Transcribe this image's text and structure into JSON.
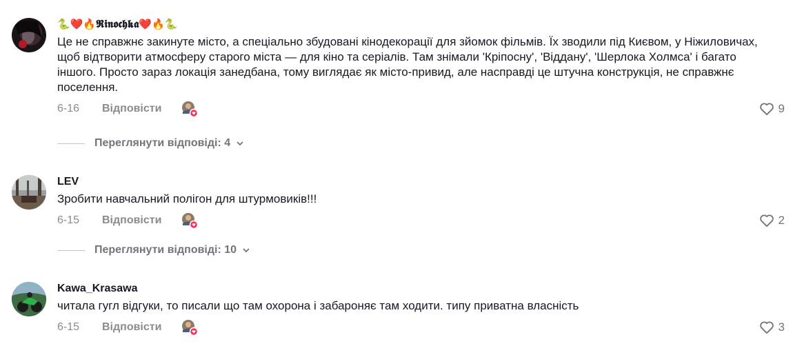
{
  "comments": [
    {
      "author_prefix": "🐍❤️🔥",
      "author_name": "𝕽𝖎𝖓𝖔𝖈𝖍𝖐𝖆",
      "author_suffix": "❤️🔥🐍",
      "text": "Це не справжнє закинуте місто, а спеціально збудовані кінодекорації для зйомок фільмів. Їх зводили під Києвом, у Ніжиловичах, щоб відтворити атмосферу старого міста — для кіно та серіалів. Там знімали 'Кріпосну', 'Віддану', 'Шерлока Холмса' і багато іншого. Просто зараз локація занедбана, тому виглядає як місто-привид, але насправді це штучна конструкція, не справжнє поселення.",
      "date": "6-16",
      "reply_label": "Відповісти",
      "likes": "9",
      "view_replies": "Переглянути відповіді: 4"
    },
    {
      "author_name": "LEV",
      "text": "Зробити навчальний полігон для штурмовиків!!!",
      "date": "6-15",
      "reply_label": "Відповісти",
      "likes": "2",
      "view_replies": "Переглянути відповіді: 10"
    },
    {
      "author_name": "Kawa_Krasawa",
      "text": "читала гугл відгуки, то писали що там охорона і забароняє там ходити. типу приватна власність",
      "date": "6-15",
      "reply_label": "Відповісти",
      "likes": "3"
    }
  ],
  "icons": {
    "like": "heart-outline-icon",
    "expand": "chevron-down-icon",
    "creator_liked": "creator-liked-avatar-icon"
  },
  "colors": {
    "text": "#161823",
    "secondary": "#8a8b91",
    "creator_heart": "#fe2c55"
  }
}
